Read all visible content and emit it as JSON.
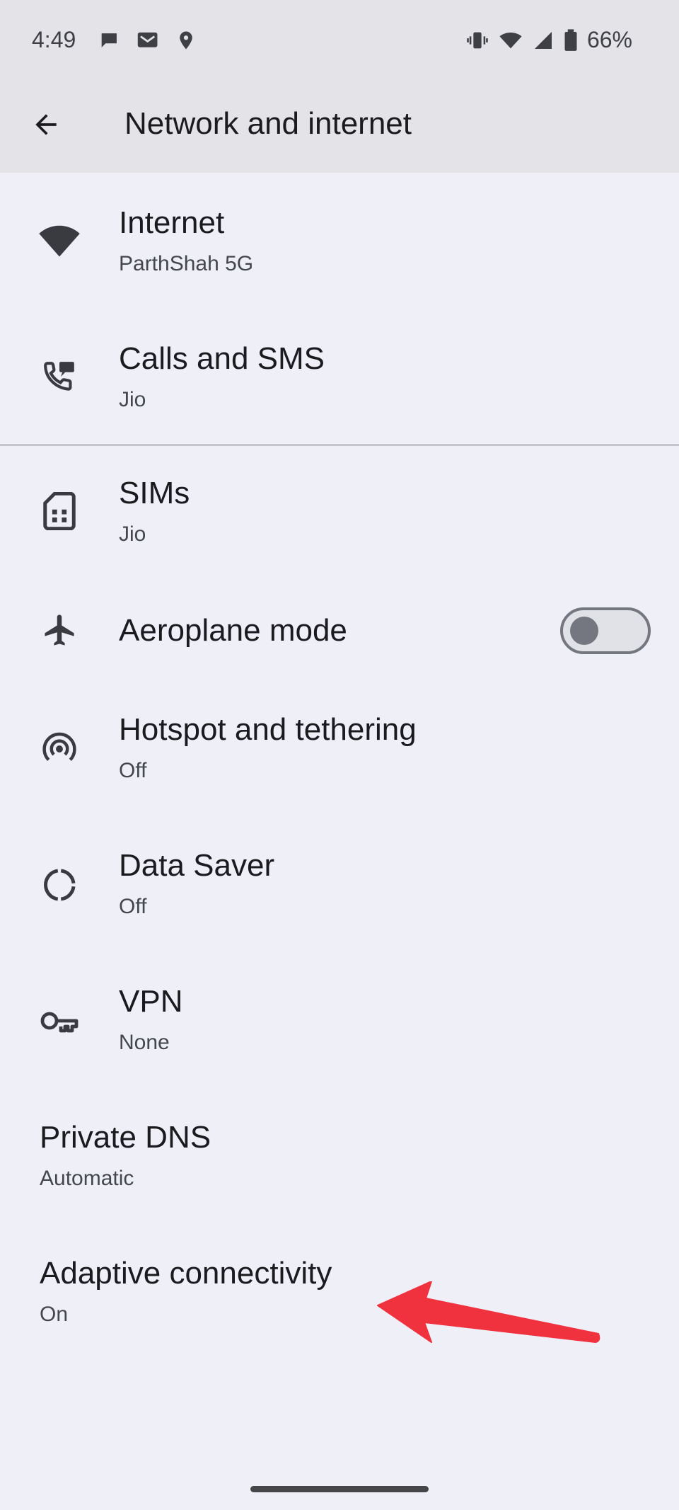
{
  "status_bar": {
    "time": "4:49",
    "battery": "66%",
    "left_icons": [
      "chat-bubble-icon",
      "message-card-icon",
      "location-pin-icon"
    ],
    "right_icons": [
      "vibrate-icon",
      "wifi-icon",
      "signal-icon",
      "battery-icon"
    ]
  },
  "app_bar": {
    "title": "Network and internet",
    "back_icon": "arrow-back-icon"
  },
  "items": [
    {
      "icon": "wifi-icon",
      "title": "Internet",
      "subtitle": "ParthShah 5G"
    },
    {
      "icon": "calls-sms-icon",
      "title": "Calls and SMS",
      "subtitle": "Jio"
    },
    {
      "icon": "sim-card-icon",
      "title": "SIMs",
      "subtitle": "Jio"
    },
    {
      "icon": "airplane-icon",
      "title": "Aeroplane mode",
      "toggle_on": false
    },
    {
      "icon": "hotspot-icon",
      "title": "Hotspot and tethering",
      "subtitle": "Off"
    },
    {
      "icon": "data-saver-icon",
      "title": "Data Saver",
      "subtitle": "Off"
    },
    {
      "icon": "vpn-key-icon",
      "title": "VPN",
      "subtitle": "None"
    },
    {
      "title": "Private DNS",
      "subtitle": "Automatic"
    },
    {
      "title": "Adaptive connectivity",
      "subtitle": "On"
    }
  ],
  "colors": {
    "background": "#eeeff7",
    "header": "#e3e3e8",
    "annotation_arrow": "#f0323f"
  }
}
